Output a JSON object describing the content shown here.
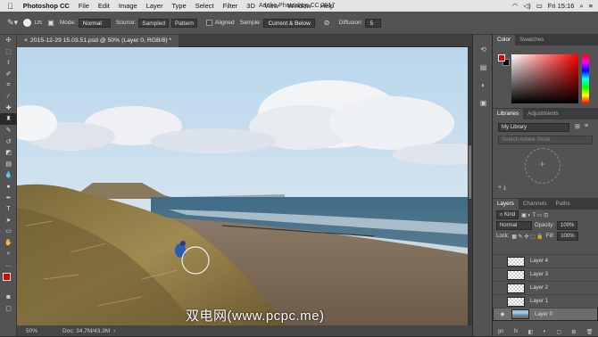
{
  "menubar": {
    "apple": "",
    "app": "Photoshop CC",
    "items": [
      "File",
      "Edit",
      "Image",
      "Layer",
      "Type",
      "Select",
      "Filter",
      "3D",
      "View",
      "Window",
      "Help"
    ],
    "window_title": "Adobe Photoshop CC 2017",
    "clock": "Fri 15:16"
  },
  "options": {
    "brush_size": "125",
    "mode_label": "Mode:",
    "mode_value": "Normal",
    "source_label": "Source:",
    "source_sampled": "Sampled",
    "source_pattern": "Pattern",
    "aligned_label": "Aligned",
    "sample_label": "Sample:",
    "sample_value": "Current & Below",
    "diffusion_label": "Diffusion:",
    "diffusion_value": "5"
  },
  "document": {
    "tab_title": "2015-12-29 15.03.51.psd @ 50% (Layer 0, RGB/8) *",
    "zoom": "50%",
    "doc_size": "Doc: 34.7M/43.3M"
  },
  "panels": {
    "color_tab": "Color",
    "swatches_tab": "Swatches",
    "libraries_tab": "Libraries",
    "adjustments_tab": "Adjustments",
    "library_name": "My Library",
    "library_search_placeholder": "Search Adobe Stock",
    "layers_tab": "Layers",
    "channels_tab": "Channels",
    "paths_tab": "Paths",
    "kind_label": "Kind",
    "blend_mode": "Normal",
    "opacity_label": "Opacity:",
    "opacity_value": "100%",
    "lock_label": "Lock:",
    "fill_label": "Fill:",
    "fill_value": "100%",
    "layers": [
      "Layer 4",
      "Layer 3",
      "Layer 2",
      "Layer 1",
      "Layer 0"
    ],
    "footer": [
      "go",
      "fx",
      "◧",
      "◐",
      "▢",
      "⊞",
      "🗑"
    ]
  },
  "watermark": "双电网(www.pcpc.me)",
  "colors": {
    "foreground": "#e00000",
    "background": "#000000"
  }
}
